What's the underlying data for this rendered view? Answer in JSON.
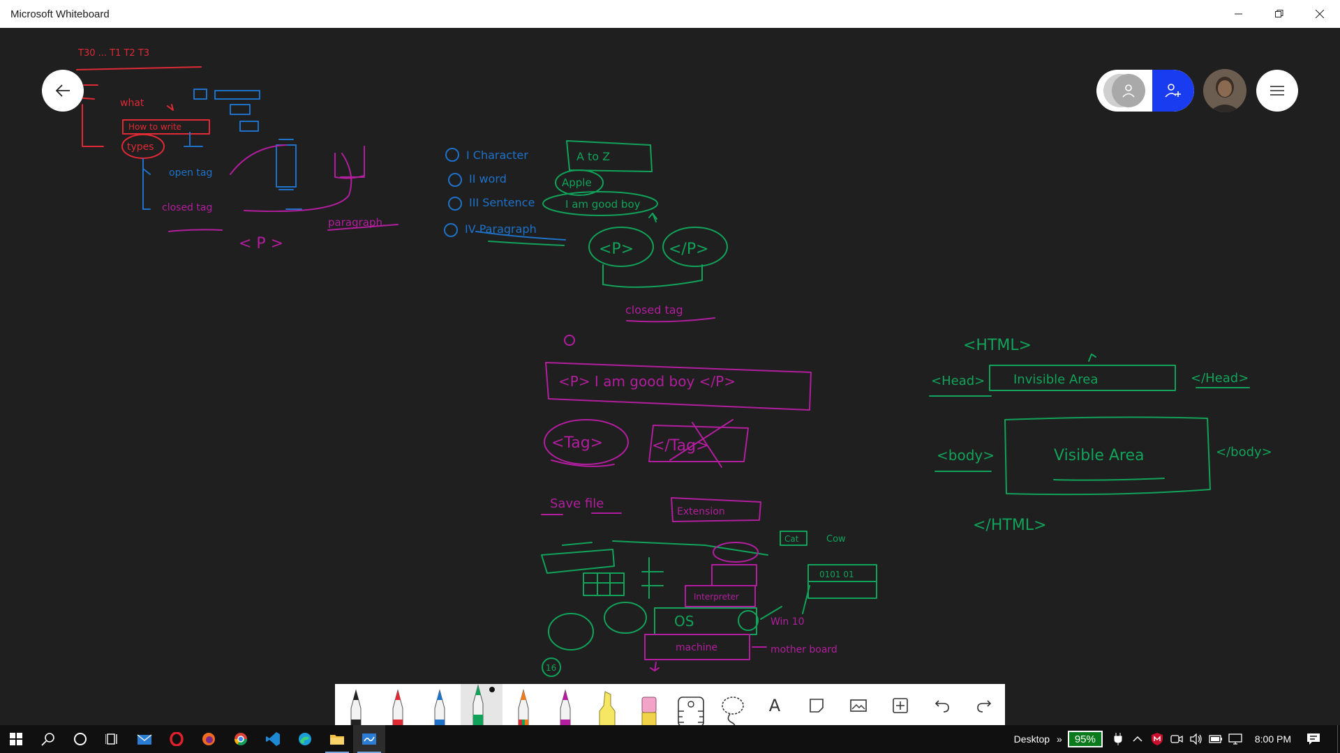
{
  "window": {
    "title": "Microsoft Whiteboard"
  },
  "colors": {
    "ink_red": "#e02a35",
    "ink_blue": "#1e72c9",
    "ink_magenta": "#b21e9e",
    "ink_green": "#11a35a",
    "invite_blue": "#1a3cf0",
    "battery_green": "#0b7a1c"
  },
  "canvas_notes": {
    "red": {
      "top": "T30 ...  T1  T2  T3",
      "what": "what",
      "how_to_write": "How to write",
      "types": "types"
    },
    "blue": {
      "open_tag": "open tag",
      "closed_tag": "closed tag"
    },
    "magenta": {
      "open_p": "< P >",
      "paragraph": "paragraph."
    },
    "list": [
      "I Character",
      "II word",
      "III Sentence",
      "IV Paragraph"
    ],
    "list_values": [
      "A to Z",
      "Apple",
      "I am good boy"
    ],
    "p_open": "<P>",
    "p_close": "</P>",
    "closed_tag": "closed tag",
    "p_example": "<P> I am good boy </P>",
    "tag_open": "<Tag>",
    "tag_close": "</Tag>",
    "save_file": "Save file",
    "extension": "Extension",
    "bottom": {
      "cat": "Cat",
      "cow": "Cow",
      "binary": "0101 01",
      "os": "OS",
      "win10": "Win 10",
      "machine": "machine",
      "motherboard": "mother board",
      "interpreter": "Interpreter",
      "count": "16"
    },
    "html_open": "<HTML>",
    "head_open": "<Head>",
    "invisible": "Invisible Area",
    "head_close": "</Head>",
    "body_open": "<body>",
    "visible": "Visible Area",
    "body_close": "</body>",
    "html_close": "</HTML>"
  },
  "toolbar": {
    "tools": [
      {
        "name": "pen-black",
        "color": "#222222"
      },
      {
        "name": "pen-red",
        "color": "#e02a35"
      },
      {
        "name": "pen-blue",
        "color": "#1e72c9"
      },
      {
        "name": "pen-green",
        "color": "#11a35a",
        "active": true
      },
      {
        "name": "pen-rainbow",
        "color": "#f07b1a"
      },
      {
        "name": "pen-galaxy",
        "color": "#b21e9e"
      },
      {
        "name": "highlighter",
        "color": "#f5e663"
      },
      {
        "name": "eraser",
        "color": "#f3a3c6"
      },
      {
        "name": "ruler",
        "color": "#ffffff"
      },
      {
        "name": "lasso",
        "color": "#ffffff"
      }
    ],
    "text_tool_label": "A"
  },
  "taskbar": {
    "desktop_label": "Desktop",
    "chevron": "»",
    "battery": "95%",
    "time": "8:00 PM"
  }
}
